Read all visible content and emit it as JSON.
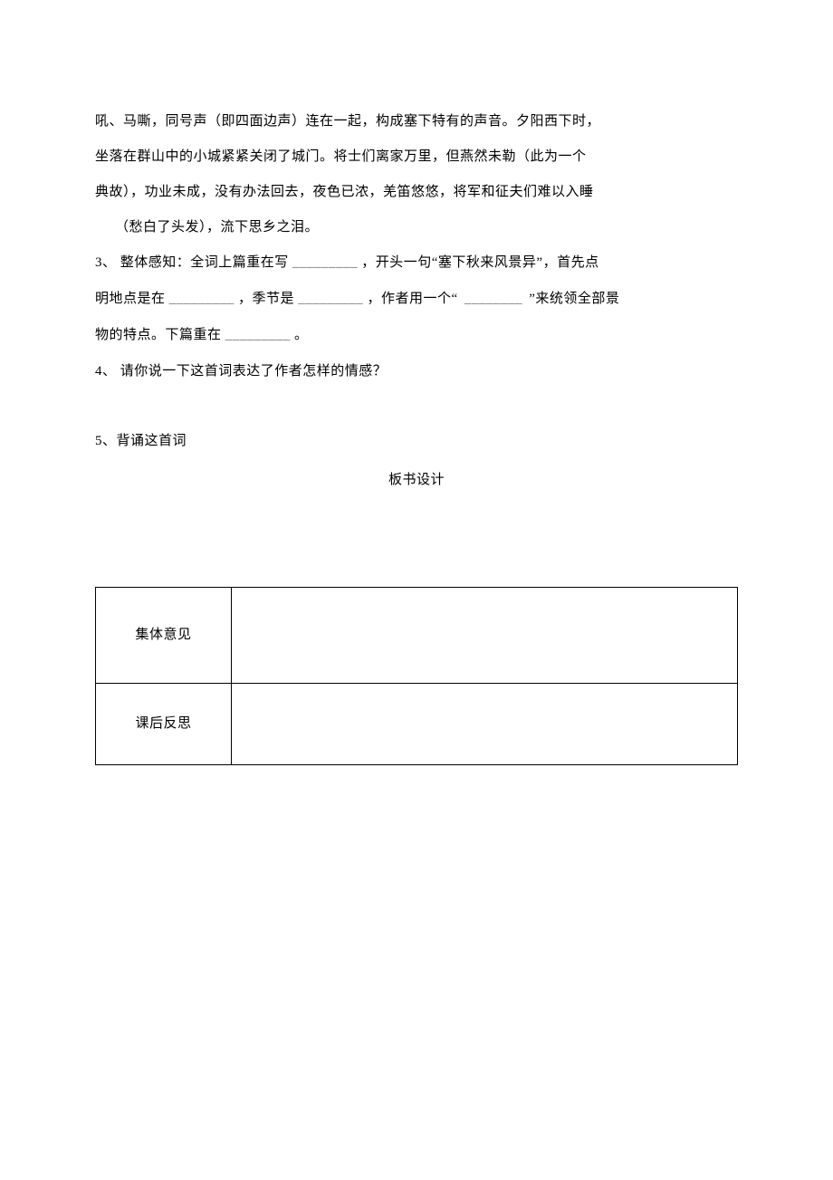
{
  "body": {
    "p1": "吼、马嘶，同号声（即四面边声）连在一起，构成塞下特有的声音。夕阳西下时，",
    "p2": "坐落在群山中的小城紧紧关闭了城门。将士们离家万里，但燕然未勒（此为一个",
    "p3": "典故），功业未成，没有办法回去，夜色已浓，羌笛悠悠，将军和征夫们难以入睡",
    "p4": "（愁白了头发），流下思乡之泪。",
    "q3_a": "3、 整体感知：全词上篇重在写",
    "q3_b": "，开头一句“塞下秋来风景异”，首先点",
    "q3_c": "明地点是在",
    "q3_d": "，季节是",
    "q3_e": "，作者用一个“",
    "q3_f": "”来统领全部景",
    "q3_g": "物的特点。下篇重在",
    "q3_h": "。",
    "q4": "4、  请你说一下这首词表达了作者怎样的情感？",
    "q5": "5、背诵这首词"
  },
  "section_title": "板书设计",
  "table": {
    "row1_label": "集体意见",
    "row1_value": "",
    "row2_label": "课后反思",
    "row2_value": ""
  },
  "blanks": {
    "b1": "_________",
    "b2": "_________",
    "b3": "_________",
    "b4": "________",
    "b5": "_________"
  }
}
